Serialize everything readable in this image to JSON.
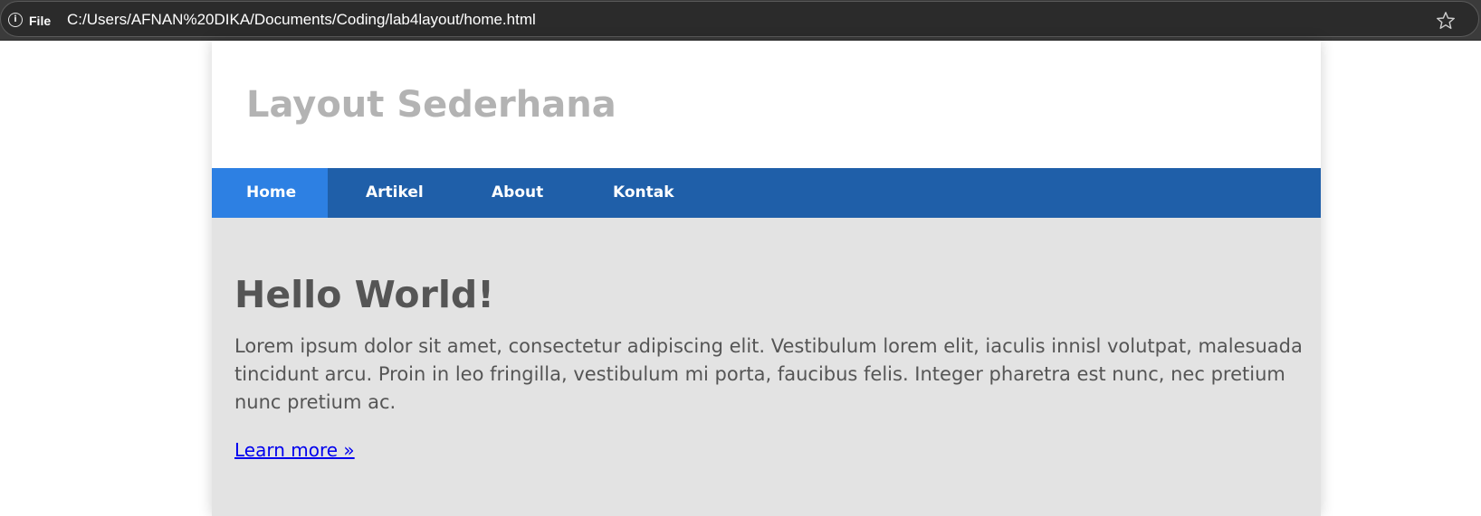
{
  "browser": {
    "info_icon": "info-icon",
    "file_label": "File",
    "url": "C:/Users/AFNAN%20DIKA/Documents/Coding/lab4layout/home.html",
    "bookmark_icon": "star-icon"
  },
  "page": {
    "title": "Layout Sederhana",
    "nav": [
      {
        "label": "Home",
        "active": true
      },
      {
        "label": "Artikel",
        "active": false
      },
      {
        "label": "About",
        "active": false
      },
      {
        "label": "Kontak",
        "active": false
      }
    ],
    "content": {
      "heading": "Hello World!",
      "paragraph": "Lorem ipsum dolor sit amet, consectetur adipiscing elit. Vestibulum lorem elit, iaculis innisl volutpat, malesuada tincidunt arcu. Proin in leo fringilla, vestibulum mi porta, faucibus felis. Integer pharetra est nunc, nec pretium nunc pretium ac.",
      "link": "Learn more »"
    }
  },
  "colors": {
    "nav_bg": "#1f5fa9",
    "nav_active": "#2d80e3",
    "content_bg": "#e3e3e3",
    "title": "#b3b3b3",
    "text": "#555555",
    "link": "#0000ee"
  }
}
